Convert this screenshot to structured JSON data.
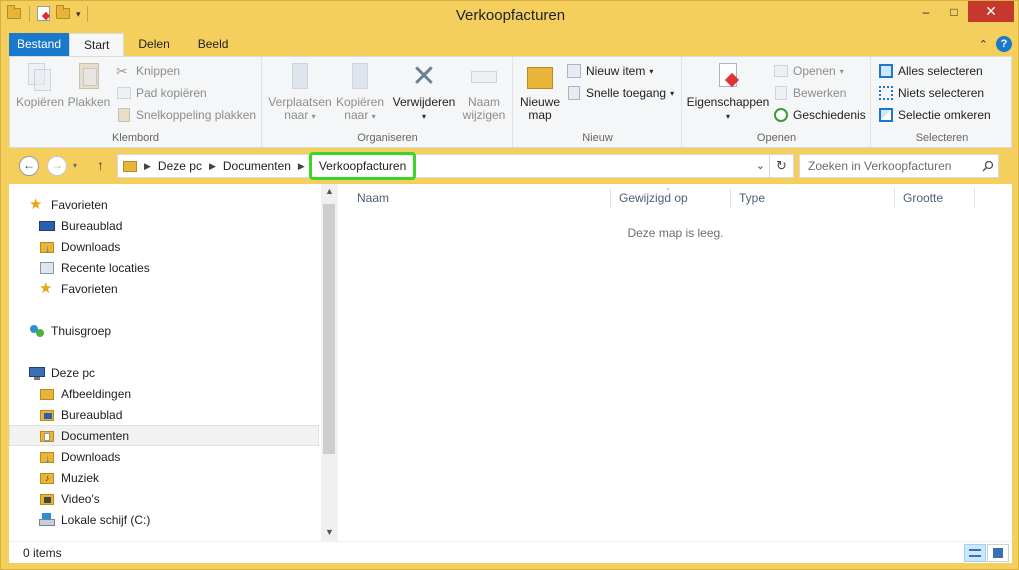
{
  "window": {
    "title": "Verkoopfacturen"
  },
  "titlebar": {
    "minimize": "–",
    "maximize": "□",
    "close": "✕"
  },
  "tabs": [
    "Bestand",
    "Start",
    "Delen",
    "Beeld"
  ],
  "ribbon": {
    "clipboard": {
      "label": "Klembord",
      "copy": "Kopiëren",
      "paste": "Plakken",
      "cut": "Knippen",
      "copy_path": "Pad kopiëren",
      "paste_shortcut": "Snelkoppeling plakken"
    },
    "organize": {
      "label": "Organiseren",
      "move_to_1": "Verplaatsen",
      "move_to_2": "naar",
      "copy_to_1": "Kopiëren",
      "copy_to_2": "naar",
      "delete": "Verwijderen",
      "rename_1": "Naam",
      "rename_2": "wijzigen"
    },
    "new": {
      "label": "Nieuw",
      "new_folder_1": "Nieuwe",
      "new_folder_2": "map",
      "new_item": "Nieuw item",
      "easy_access": "Snelle toegang"
    },
    "open": {
      "label": "Openen",
      "properties": "Eigenschappen",
      "open": "Openen",
      "edit": "Bewerken",
      "history": "Geschiedenis"
    },
    "select": {
      "label": "Selecteren",
      "select_all": "Alles selecteren",
      "select_none": "Niets selecteren",
      "invert": "Selectie omkeren"
    }
  },
  "address": {
    "crumbs": [
      "Deze pc",
      "Documenten",
      "Verkoopfacturen"
    ]
  },
  "search": {
    "placeholder": "Zoeken in Verkoopfacturen"
  },
  "navpane": {
    "items": [
      {
        "label": "Favorieten",
        "icon": "star-icon"
      },
      {
        "label": "Bureaublad",
        "icon": "desktop-icon"
      },
      {
        "label": "Downloads",
        "icon": "downloads-icon"
      },
      {
        "label": "Recente locaties",
        "icon": "recent-icon"
      },
      {
        "label": "Favorieten",
        "icon": "star-icon"
      },
      {
        "label": "Thuisgroep",
        "icon": "homegroup-icon"
      },
      {
        "label": "Deze pc",
        "icon": "computer-icon"
      },
      {
        "label": "Afbeeldingen",
        "icon": "pictures-folder-icon"
      },
      {
        "label": "Bureaublad",
        "icon": "desktop-folder-icon"
      },
      {
        "label": "Documenten",
        "icon": "documents-folder-icon"
      },
      {
        "label": "Downloads",
        "icon": "downloads-folder-icon"
      },
      {
        "label": "Muziek",
        "icon": "music-folder-icon"
      },
      {
        "label": "Video's",
        "icon": "videos-folder-icon"
      },
      {
        "label": "Lokale schijf (C:)",
        "icon": "drive-icon"
      }
    ]
  },
  "filepane": {
    "columns": [
      "Naam",
      "Gewijzigd op",
      "Type",
      "Grootte"
    ],
    "empty_text": "Deze map is leeg."
  },
  "status": {
    "items": "0 items"
  },
  "colors": {
    "accent": "#1979ca",
    "frame": "#f5cf5e",
    "highlight": "#3cd529"
  }
}
